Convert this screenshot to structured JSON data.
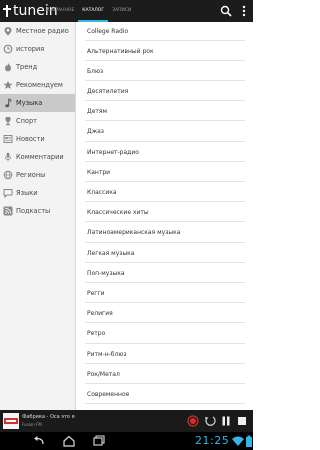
{
  "app": {
    "logo_text": "tunein",
    "tabs": [
      {
        "label": "ИЗБРАННОЕ",
        "active": false
      },
      {
        "label": "КАТАЛОГ",
        "active": true
      },
      {
        "label": "ЗАПИСИ",
        "active": false
      }
    ],
    "accent_color": "#33b5e5",
    "icons": [
      "search-icon",
      "overflow-menu-icon"
    ]
  },
  "sidebar": {
    "items": [
      {
        "label": "Местное радио",
        "icon": "location-pin-icon",
        "active": false
      },
      {
        "label": "история",
        "icon": "history-clock-icon",
        "active": false
      },
      {
        "label": "Тренд",
        "icon": "trending-icon",
        "active": false
      },
      {
        "label": "Рекомендуем",
        "icon": "star-icon",
        "active": false
      },
      {
        "label": "Музыка",
        "icon": "music-note-icon",
        "active": true
      },
      {
        "label": "Спорт",
        "icon": "trophy-icon",
        "active": false
      },
      {
        "label": "Новости",
        "icon": "news-icon",
        "active": false
      },
      {
        "label": "Комментарии",
        "icon": "microphone-icon",
        "active": false
      },
      {
        "label": "Регионы",
        "icon": "globe-icon",
        "active": false
      },
      {
        "label": "Языки",
        "icon": "speech-bubble-icon",
        "active": false
      },
      {
        "label": "Подкасты",
        "icon": "rss-icon",
        "active": false
      }
    ]
  },
  "genres": [
    "College Radio",
    "Альтернативный рок",
    "Блюз",
    "Десятилетия",
    "Детям",
    "Джаз",
    "Интернет-радио",
    "Кантри",
    "Классика",
    "Классические хиты",
    "Латиноамериканская музыка",
    "Легкая музыка",
    "Поп-музыка",
    "Регги",
    "Религия",
    "Ретро",
    "Ритм-н-блюз",
    "Рок/Метал",
    "Современное"
  ],
  "player": {
    "line1": "Фабрика - Оса это я",
    "line2": "Fusion FM"
  },
  "status": {
    "clock": "21:25"
  }
}
